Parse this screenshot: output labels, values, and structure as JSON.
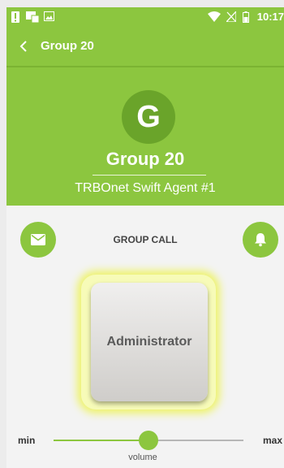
{
  "status_bar": {
    "time": "10:17",
    "icons": [
      "alert-icon",
      "sim-card-icon",
      "image-icon",
      "wifi-icon",
      "signal-icon",
      "battery-icon"
    ]
  },
  "toolbar": {
    "title": "Group 20"
  },
  "header": {
    "avatar_letter": "G",
    "title": "Group 20",
    "subtitle": "TRBOnet Swift Agent #1"
  },
  "call": {
    "label": "GROUP CALL",
    "ptt_label": "Administrator"
  },
  "volume": {
    "min_label": "min",
    "max_label": "max",
    "label": "volume",
    "level": 0.5
  },
  "colors": {
    "accent": "#8cc63f",
    "accent_dark": "#6aa42a",
    "glow": "#eef36a"
  }
}
